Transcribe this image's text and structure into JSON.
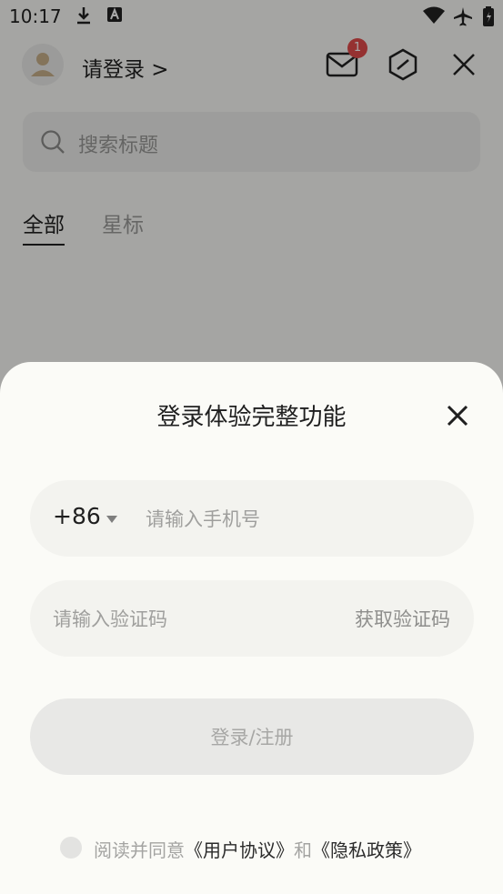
{
  "status_bar": {
    "time": "10:17"
  },
  "header": {
    "login_text": "请登录 >",
    "mail_badge": "1"
  },
  "search": {
    "placeholder": "搜索标题"
  },
  "tabs": [
    {
      "label": "全部"
    },
    {
      "label": "星标"
    }
  ],
  "login_sheet": {
    "title": "登录体验完整功能",
    "country_code": "+86",
    "phone_placeholder": "请输入手机号",
    "code_placeholder": "请输入验证码",
    "get_code_label": "获取验证码",
    "submit_label": "登录/注册",
    "agreement": {
      "prefix": "阅读并同意",
      "user_agreement": "《用户协议》",
      "and": "和",
      "privacy_policy": "《隐私政策》"
    }
  },
  "colors": {
    "badge": "#e24b4b",
    "overlay": "rgba(0,0,0,0.34)",
    "sheet_bg": "#fbfbf7"
  }
}
